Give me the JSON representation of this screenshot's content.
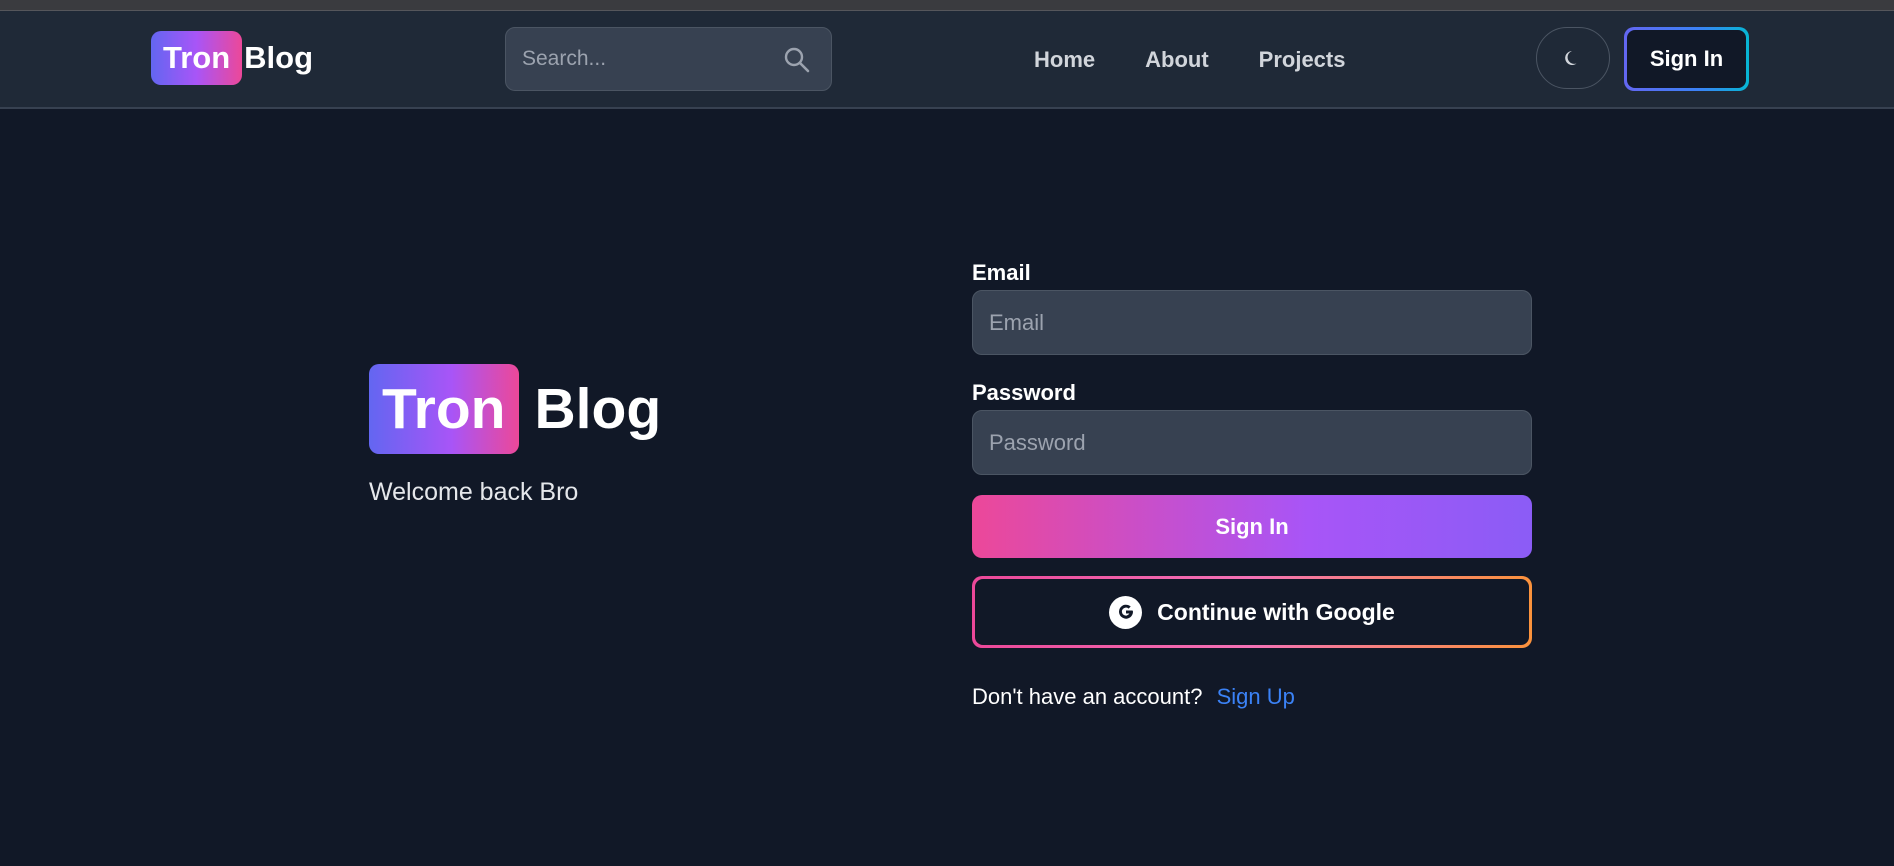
{
  "navbar": {
    "logo_badge": "Tron",
    "logo_text": "Blog",
    "search_placeholder": "Search...",
    "links": [
      "Home",
      "About",
      "Projects"
    ],
    "signin_label": "Sign In"
  },
  "hero": {
    "logo_badge": "Tron",
    "logo_text": "Blog",
    "subtitle": "Welcome back Bro"
  },
  "form": {
    "email_label": "Email",
    "email_placeholder": "Email",
    "password_label": "Password",
    "password_placeholder": "Password",
    "signin_button": "Sign In",
    "google_button": "Continue with Google",
    "signup_prompt": "Don't have an account?",
    "signup_link": "Sign Up"
  },
  "icons": {
    "search": "search-icon",
    "theme": "moon-icon",
    "google": "google-icon"
  },
  "colors": {
    "background": "#111827",
    "navbar": "#1f2937",
    "input": "#374151",
    "link": "#3b82f6"
  }
}
